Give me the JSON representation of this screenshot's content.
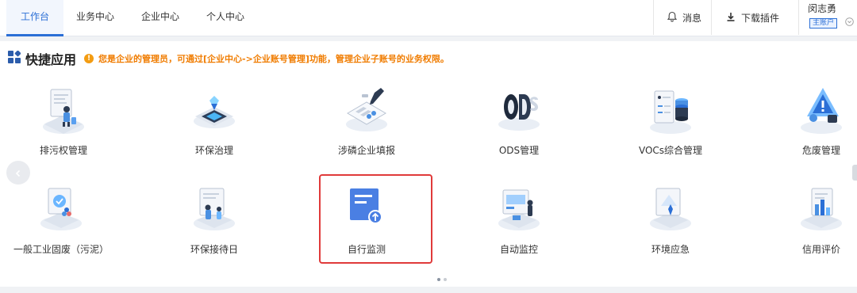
{
  "topbar": {
    "tabs": [
      {
        "label": "工作台",
        "active": true
      },
      {
        "label": "业务中心",
        "active": false
      },
      {
        "label": "企业中心",
        "active": false
      },
      {
        "label": "个人中心",
        "active": false
      }
    ],
    "messages_label": "消息",
    "download_plugin_label": "下载插件",
    "user_name": "闵志勇",
    "account_badge": "主账户"
  },
  "quick_apps": {
    "title": "快捷应用",
    "notice": "您是企业的管理员，可通过[企业中心->企业账号管理]功能，管理企业子账号的业务权限。",
    "row1": [
      {
        "label": "排污权管理",
        "icon": "office-worker-icon"
      },
      {
        "label": "环保治理",
        "icon": "eco-governance-icon"
      },
      {
        "label": "涉磷企业填报",
        "icon": "form-fill-icon"
      },
      {
        "label": "ODS管理",
        "icon": "ods-icon"
      },
      {
        "label": "VOCs综合管理",
        "icon": "vocs-database-icon"
      },
      {
        "label": "危废管理",
        "icon": "hazard-warning-icon"
      }
    ],
    "row2": [
      {
        "label": "一般工业固废（污泥）",
        "icon": "solid-waste-icon"
      },
      {
        "label": "环保接待日",
        "icon": "reception-day-icon"
      },
      {
        "label": "自行监测",
        "icon": "document-upload-icon",
        "highlighted": true
      },
      {
        "label": "自动监控",
        "icon": "auto-monitor-icon"
      },
      {
        "label": "环境应急",
        "icon": "emergency-icon"
      },
      {
        "label": "信用评价",
        "icon": "credit-rating-icon"
      }
    ]
  },
  "colors": {
    "primary": "#2b6fd6",
    "notice": "#f07c00",
    "highlight_border": "#e03a3a"
  }
}
